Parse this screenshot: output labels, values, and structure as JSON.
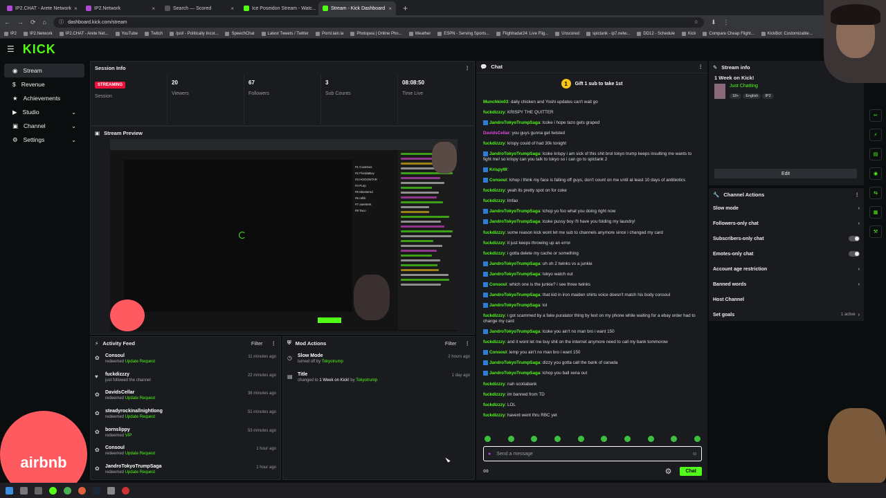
{
  "browser": {
    "tabs": [
      {
        "label": "IP2.CHAT - Arete Network",
        "color": "#b04ad6"
      },
      {
        "label": "IP2.Network",
        "color": "#b04ad6"
      },
      {
        "label": "Search — Scored",
        "color": "#555555"
      },
      {
        "label": "Ice Poseidon Stream - Watc...",
        "color": "#53fc18"
      },
      {
        "label": "Stream - Kick Dashboard",
        "color": "#53fc18",
        "active": true
      }
    ],
    "url": "dashboard.kick.com/stream",
    "bookmarks": [
      "IP2",
      "IP2.Network",
      "IP2.CHAT - Arete Net...",
      "YouTube",
      "Twitch",
      "/pol/ - Politically Incor...",
      "SpeechChat",
      "Latest Tweets / Twitter",
      "Pornl.lain.la",
      "Photopea | Online Pho...",
      "Weather",
      "ESPN - Serving Sports...",
      "Flightradar24: Live Flig...",
      "Unscored",
      "spictank - ip7.netw...",
      "DD12 - Schedule",
      "Kick",
      "Compare Cheap Flight...",
      "KickBot: Customizable..."
    ]
  },
  "app": {
    "logo": "KICK",
    "accent": "#53fc18"
  },
  "sidebar": {
    "items": [
      {
        "label": "Stream",
        "icon": "stream-icon",
        "active": true
      },
      {
        "label": "Revenue",
        "icon": "revenue-icon"
      },
      {
        "label": "Achievements",
        "icon": "achievements-icon"
      },
      {
        "label": "Studio",
        "icon": "studio-icon",
        "chevron": true
      },
      {
        "label": "Channel",
        "icon": "channel-icon",
        "chevron": true
      },
      {
        "label": "Settings",
        "icon": "gear-icon",
        "chevron": true
      }
    ]
  },
  "session": {
    "title": "Session Info",
    "badge": "STREAMING",
    "badge_label": "Session",
    "stats": [
      {
        "value": "20",
        "label": "Viewers"
      },
      {
        "value": "67",
        "label": "Followers"
      },
      {
        "value": "3",
        "label": "Sub Counts"
      },
      {
        "value": "08:08:50",
        "label": "Time Live"
      }
    ]
  },
  "preview": {
    "title": "Stream Preview",
    "list": [
      "#1 CookSus",
      "#2 FloridaBoy",
      "#3 HOOONTAR",
      "#4 Purp",
      "#5 Mixstered",
      "#6 rellik",
      "#7 asentent",
      "#8 Taco"
    ]
  },
  "activity": {
    "title": "Activity Feed",
    "filter": "Filter",
    "items": [
      {
        "name": "Consoul",
        "pre": "redeemed",
        "action": "Update Request",
        "time": "11 minutes ago",
        "icon": "redeem-icon"
      },
      {
        "name": "fuckdizzzy",
        "pre": "just followed the channel",
        "action": "",
        "time": "22 minutes ago",
        "icon": "heart-icon"
      },
      {
        "name": "DavidsCellar",
        "pre": "redeemed",
        "action": "Update Request",
        "time": "38 minutes ago",
        "icon": "redeem-icon"
      },
      {
        "name": "steadyrockinallnightlong",
        "pre": "redeemed",
        "action": "Update Request",
        "time": "51 minutes ago",
        "icon": "redeem-icon"
      },
      {
        "name": "bornslippy",
        "pre": "redeemed",
        "action": "VIP",
        "time": "53 minutes ago",
        "icon": "redeem-icon"
      },
      {
        "name": "Consoul",
        "pre": "redeemed",
        "action": "Update Request",
        "time": "1 hour ago",
        "icon": "redeem-icon"
      },
      {
        "name": "JandroTokyoTrumpSaga",
        "pre": "redeemed",
        "action": "Update Request",
        "time": "1 hour ago",
        "icon": "redeem-icon"
      }
    ]
  },
  "modactions": {
    "title": "Mod Actions",
    "filter": "Filter",
    "items": [
      {
        "name": "Slow Mode",
        "pre": "turned off by",
        "by": "Tokyotrump",
        "time": "2 hours ago"
      },
      {
        "name": "Title",
        "pre": "changed to",
        "value": "1 Week on Kick!",
        "mid": "by",
        "by": "Tokyotrump",
        "time": "1 day ago"
      }
    ]
  },
  "chat": {
    "title": "Chat",
    "gift": "Gift 1 sub to take 1st",
    "placeholder": "Send a message",
    "send": "Chat",
    "messages": [
      {
        "user": "Munchkin03",
        "color": "#53fc18",
        "text": "daily chicken and Yoshi updates can't wait go"
      },
      {
        "user": "fuckdizzzy",
        "color": "#53fc18",
        "text": "KRISPY THE QUITTER"
      },
      {
        "user": "JandroTokyoTrumpSaga",
        "color": "#53fc18",
        "badge": true,
        "text": "lcoke i hope tazo gets graped"
      },
      {
        "user": "DavidsCellar",
        "color": "#e24ae0",
        "text": "you guys gunna get twisted"
      },
      {
        "user": "fuckdizzzy",
        "color": "#53fc18",
        "text": "krispy could of had 30k tonight"
      },
      {
        "user": "JandroTokyoTrumpSaga",
        "color": "#53fc18",
        "badge": true,
        "text": "lcoke krispy i am sick of this shit brol tokyo trump keeps insulting me wants to fight me! so krispy can you talk to tokyo so i can go to spictank 2"
      },
      {
        "user": "KrispyW",
        "color": "#53fc18",
        "badge": true,
        "text": ""
      },
      {
        "user": "Consoul",
        "color": "#53fc18",
        "badge": true,
        "text": "lchop i think my face is falling off guys, don't count on me until at least 10 days of antibiotics"
      },
      {
        "user": "fuckdizzzy",
        "color": "#53fc18",
        "text": "yeah its pretty spot on for coke"
      },
      {
        "user": "fuckdizzzy",
        "color": "#53fc18",
        "text": "lmfao"
      },
      {
        "user": "JandroTokyoTrumpSaga",
        "color": "#53fc18",
        "badge": true,
        "text": "lchop yo foo what you doing right now"
      },
      {
        "user": "JandroTokyoTrumpSaga",
        "color": "#53fc18",
        "badge": true,
        "text": "lcoke pussy boy i'll have you folding my laundry!"
      },
      {
        "user": "fuckdizzzy",
        "color": "#53fc18",
        "text": "some reason kick wont let me sub to channels anymore since i changed my card"
      },
      {
        "user": "fuckdizzzy",
        "color": "#53fc18",
        "text": "it just keeps throwing up an error"
      },
      {
        "user": "fuckdizzzy",
        "color": "#53fc18",
        "text": "i gotta delete my cache or something"
      },
      {
        "user": "JandroTokyoTrumpSaga",
        "color": "#53fc18",
        "badge": true,
        "text": "uh oh 2 twinks vs a junkie"
      },
      {
        "user": "JandroTokyoTrumpSaga",
        "color": "#53fc18",
        "badge": true,
        "text": "tokyo watch out"
      },
      {
        "user": "Consoul",
        "color": "#53fc18",
        "badge": true,
        "text": "which one is the junkie? i see three twinks"
      },
      {
        "user": "JandroTokyoTrumpSaga",
        "color": "#53fc18",
        "badge": true,
        "text": "that kid in iron maiden shirts voice doesn't match his body consoul"
      },
      {
        "user": "JandroTokyoTrumpSaga",
        "color": "#53fc18",
        "badge": true,
        "text": "lol"
      },
      {
        "user": "fuckdizzzy",
        "color": "#53fc18",
        "text": "i got scammed by a fake puralator thing by text on my phone while waiting for a ebay order had to change my card"
      },
      {
        "user": "JandroTokyoTrumpSaga",
        "color": "#53fc18",
        "badge": true,
        "text": "lcoke you ain't no man bro i want 150"
      },
      {
        "user": "fuckdizzzy",
        "color": "#53fc18",
        "text": "and it wont let me buy shit on the internet anymore need to call my bank tommorow"
      },
      {
        "user": "Consoul",
        "color": "#53fc18",
        "badge": true,
        "text": "lemp you ain't no man bro i want 150"
      },
      {
        "user": "JandroTokyoTrumpSaga",
        "color": "#53fc18",
        "badge": true,
        "text": "dizzy you gotta call the bank of canada"
      },
      {
        "user": "JandroTokyoTrumpSaga",
        "color": "#53fc18",
        "badge": true,
        "text": "lchop you ball xena out"
      },
      {
        "user": "fuckdizzzy",
        "color": "#53fc18",
        "text": "nah scotiabank"
      },
      {
        "user": "fuckdizzzy",
        "color": "#53fc18",
        "text": "im banned from TD"
      },
      {
        "user": "fuckdizzzy",
        "color": "#53fc18",
        "text": "LOL"
      },
      {
        "user": "fuckdizzzy",
        "color": "#53fc18",
        "text": "havent went thru RBC yet"
      }
    ]
  },
  "streaminfo": {
    "title": "Stream info",
    "stream_title": "1 Week on Kick!",
    "category": "Just Chatting",
    "tags": [
      "18+",
      "English",
      "IP2"
    ],
    "edit": "Edit"
  },
  "channelactions": {
    "title": "Channel Actions",
    "items": [
      {
        "label": "Slow mode",
        "kind": "chevron"
      },
      {
        "label": "Followers-only chat",
        "kind": "chevron"
      },
      {
        "label": "Subscribers-only chat",
        "kind": "toggle"
      },
      {
        "label": "Emotes-only chat",
        "kind": "toggle"
      },
      {
        "label": "Account age restriction",
        "kind": "chevron"
      },
      {
        "label": "Banned words",
        "kind": "chevron"
      },
      {
        "label": "Host Channel",
        "kind": "none"
      },
      {
        "label": "Set goals",
        "kind": "chevron",
        "extra": "1 active"
      }
    ]
  },
  "overlay": {
    "airbnb": "airbnb"
  }
}
